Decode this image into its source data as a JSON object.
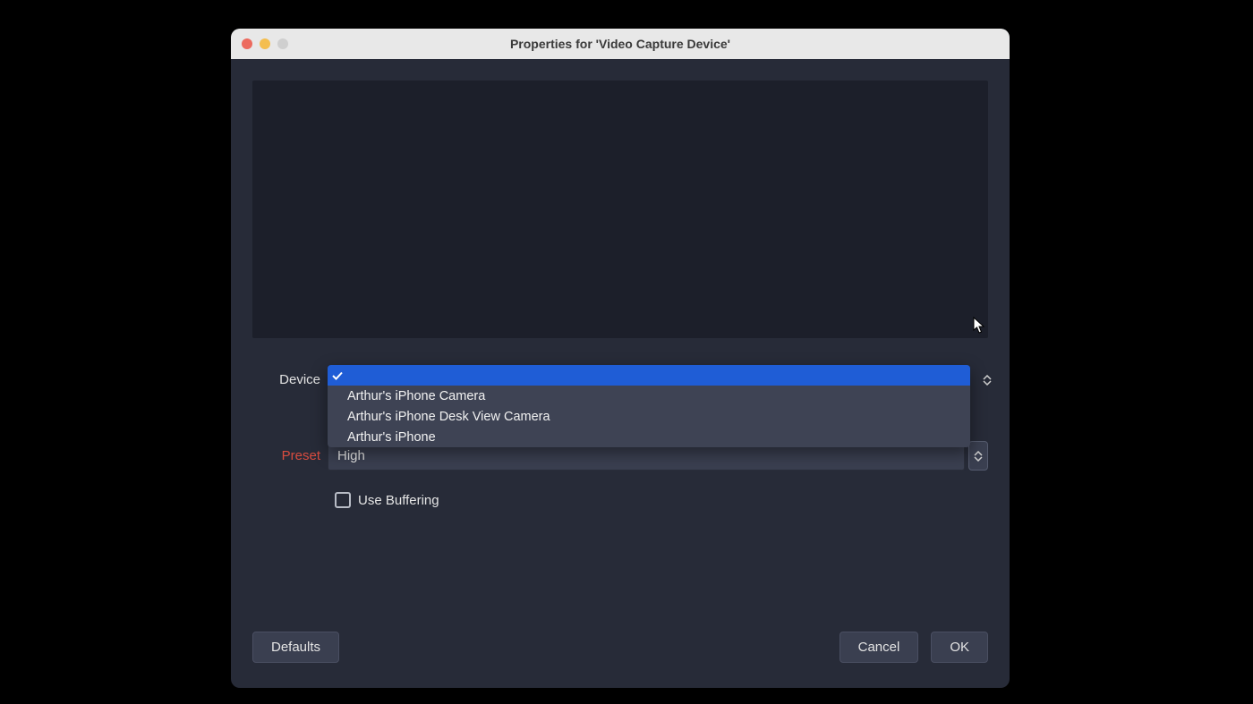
{
  "window": {
    "title": "Properties for 'Video Capture Device'"
  },
  "form": {
    "device_label": "Device",
    "preset_label": "Preset",
    "preset_value": "High",
    "use_buffering_label": "Use Buffering"
  },
  "device_dropdown": {
    "options": [
      {
        "label": "",
        "selected": true
      },
      {
        "label": "Arthur's iPhone Camera",
        "selected": false
      },
      {
        "label": "Arthur's iPhone Desk View Camera",
        "selected": false
      },
      {
        "label": "Arthur's iPhone",
        "selected": false
      }
    ]
  },
  "footer": {
    "defaults": "Defaults",
    "cancel": "Cancel",
    "ok": "OK"
  }
}
